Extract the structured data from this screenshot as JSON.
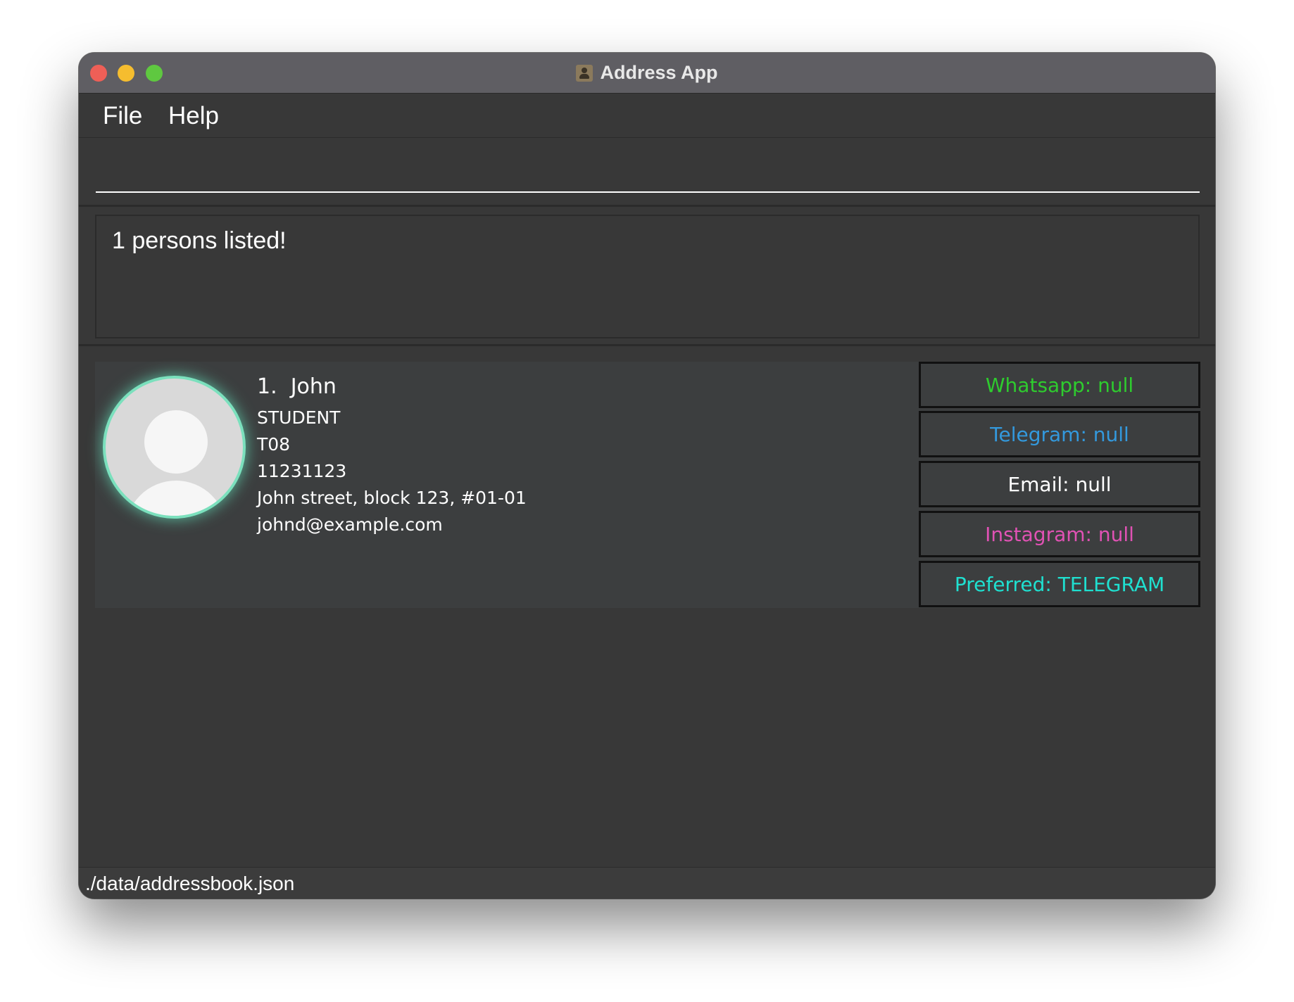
{
  "window": {
    "title": "Address App"
  },
  "menu": {
    "file": "File",
    "help": "Help"
  },
  "command": {
    "value": "",
    "placeholder": ""
  },
  "result": {
    "message": "1 persons listed!"
  },
  "persons": [
    {
      "index": "1.",
      "name": "John",
      "role": "STUDENT",
      "tutorial": "T08",
      "phone": "11231123",
      "address": "John street, block 123, #01-01",
      "email": "johnd@example.com",
      "contacts": {
        "whatsapp": "Whatsapp: null",
        "telegram": "Telegram: null",
        "email": "Email: null",
        "instagram": "Instagram: null",
        "preferred": "Preferred: TELEGRAM"
      }
    }
  ],
  "status": {
    "file_path": "./data/addressbook.json"
  },
  "colors": {
    "whatsapp": "#2ecc2e",
    "telegram": "#3399dd",
    "email": "#ffffff",
    "instagram": "#e052b4",
    "preferred": "#1fe0d0",
    "avatar_glow": "#7be0bd"
  }
}
